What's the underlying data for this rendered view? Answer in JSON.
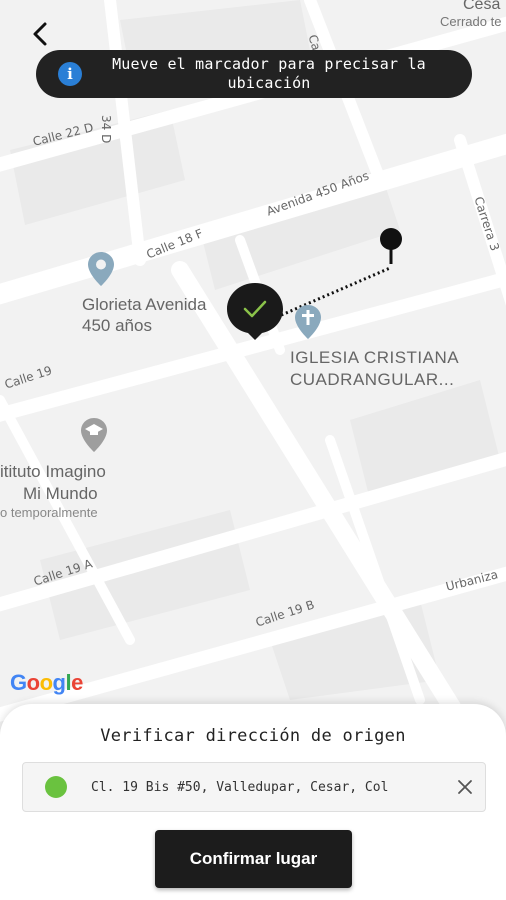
{
  "banner": {
    "icon": "info-icon",
    "message": "Mueve el marcador para precisar la ubicación"
  },
  "map": {
    "streets": {
      "calle_22d": "Calle 22 D",
      "cra_34d": "34 D",
      "avenida_450": "Avenida 450 Años",
      "calle_18f": "Calle 18 F",
      "calle_19": "Calle 19",
      "calle_19a": "Calle 19 A",
      "calle_19b": "Calle 19 B",
      "carrera_top": "Carre",
      "carrera_right": "Carrera 3",
      "urbanizacion": "Urbaniza"
    },
    "top_right": {
      "line1": "Cesa",
      "line2": "Cerrado te"
    },
    "poi": {
      "glorieta": {
        "line1": "Glorieta Avenida",
        "line2": "450 años"
      },
      "iglesia": {
        "line1": "IGLESIA CRISTIANA",
        "line2": "CUADRANGULAR..."
      },
      "instituto": {
        "line1": "itituto Imagino",
        "line2": "Mi Mundo",
        "line3": "o temporalmente"
      }
    },
    "google_logo": [
      "G",
      "o",
      "o",
      "g",
      "l",
      "e"
    ],
    "colors": {
      "roads": "#ffffff",
      "background": "#f2f2f2",
      "route": "#111111",
      "check": "#8bc34a"
    }
  },
  "sheet": {
    "title": "Verificar dirección de origen",
    "address": "Cl. 19 Bis #50, Valledupar, Cesar, Col",
    "address_dot_color": "#6ac23f",
    "confirm_label": "Confirmar lugar"
  }
}
